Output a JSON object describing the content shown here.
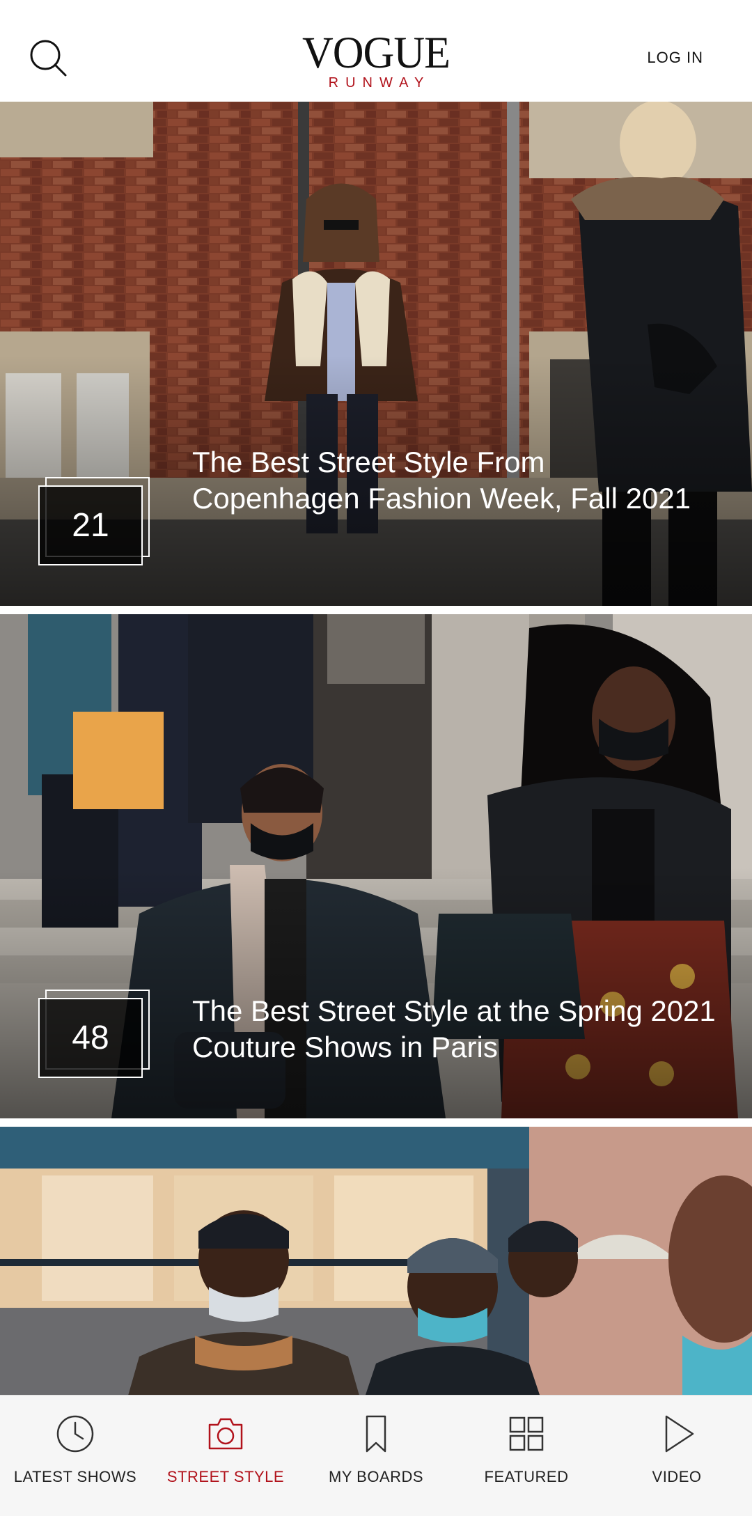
{
  "header": {
    "logo_top": "VOGUE",
    "logo_bottom": "RUNWAY",
    "login_label": "LOG IN",
    "search_icon": "search-icon"
  },
  "feed": {
    "cards": [
      {
        "count": "21",
        "title": "The Best Street Style From Copenhagen Fashion Week, Fall 2021"
      },
      {
        "count": "48",
        "title": "The Best Street Style at the Spring 2021 Couture Shows in Paris"
      }
    ]
  },
  "bottom_nav": {
    "active": "STREET STYLE",
    "items": [
      {
        "label": "LATEST SHOWS",
        "icon": "clock-icon"
      },
      {
        "label": "STREET STYLE",
        "icon": "camera-icon"
      },
      {
        "label": "MY BOARDS",
        "icon": "bookmark-icon"
      },
      {
        "label": "FEATURED",
        "icon": "grid-icon"
      },
      {
        "label": "VIDEO",
        "icon": "play-icon"
      }
    ]
  },
  "colors": {
    "accent": "#b1121b",
    "text": "#111111",
    "nav_bg": "#f6f6f6"
  }
}
